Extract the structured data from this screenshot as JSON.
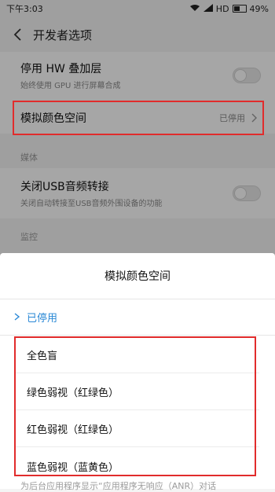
{
  "status": {
    "time": "下午3:03",
    "network": "HD",
    "battery": "49%"
  },
  "header": {
    "title": "开发者选项"
  },
  "settings": {
    "hw_overlay": {
      "title": "停用 HW 叠加层",
      "subtitle": "始终使用 GPU 进行屏幕合成"
    },
    "color_space": {
      "title": "模拟颜色空间",
      "value": "已停用"
    },
    "media_label": "媒体",
    "usb_audio": {
      "title": "关闭USB音频转接",
      "subtitle": "关闭自动转接至USB音频外围设备的功能"
    },
    "monitor_label": "监控",
    "bottom_peek": "为后台应用程序显示“应用程序无响应（ANR）对话"
  },
  "dialog": {
    "title": "模拟颜色空间",
    "options": [
      "已停用",
      "全色盲",
      "绿色弱视（红绿色）",
      "红色弱视（红绿色）",
      "蓝色弱视（蓝黄色）"
    ],
    "selected_index": 0,
    "accent_color": "#2a88d6"
  },
  "icons": {
    "back": "chevron-left-icon",
    "wifi": "wifi-icon",
    "signal": "signal-icon",
    "battery": "battery-icon",
    "chevron": "chevron-right-icon",
    "check": "check-icon"
  }
}
